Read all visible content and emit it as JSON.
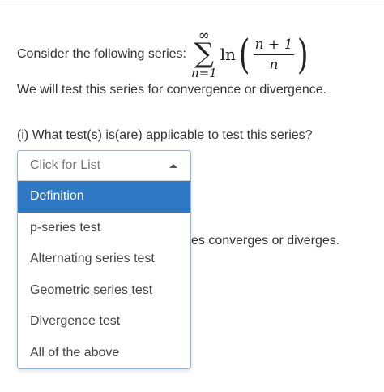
{
  "problem": {
    "intro": "Consider the following series:",
    "series": {
      "sum_upper": "∞",
      "sum_symbol": "∑",
      "sum_lower": "n=1",
      "function": "ln",
      "numerator": "n + 1",
      "denominator": "n"
    },
    "statement": "We will test this series for convergence or divergence."
  },
  "question": {
    "text": "(i) What test(s) is(are) applicable to test this series?",
    "partially_hidden_text": "es converges or diverges."
  },
  "dropdown": {
    "placeholder": "Click for List",
    "options": [
      "Definition",
      "p-series test",
      "Alternating series test",
      "Geometric series test",
      "Divergence test",
      "All of the above"
    ],
    "highlighted_option": "Definition"
  },
  "colors": {
    "highlight": "#2f78c4",
    "border": "#8fb4dd"
  }
}
